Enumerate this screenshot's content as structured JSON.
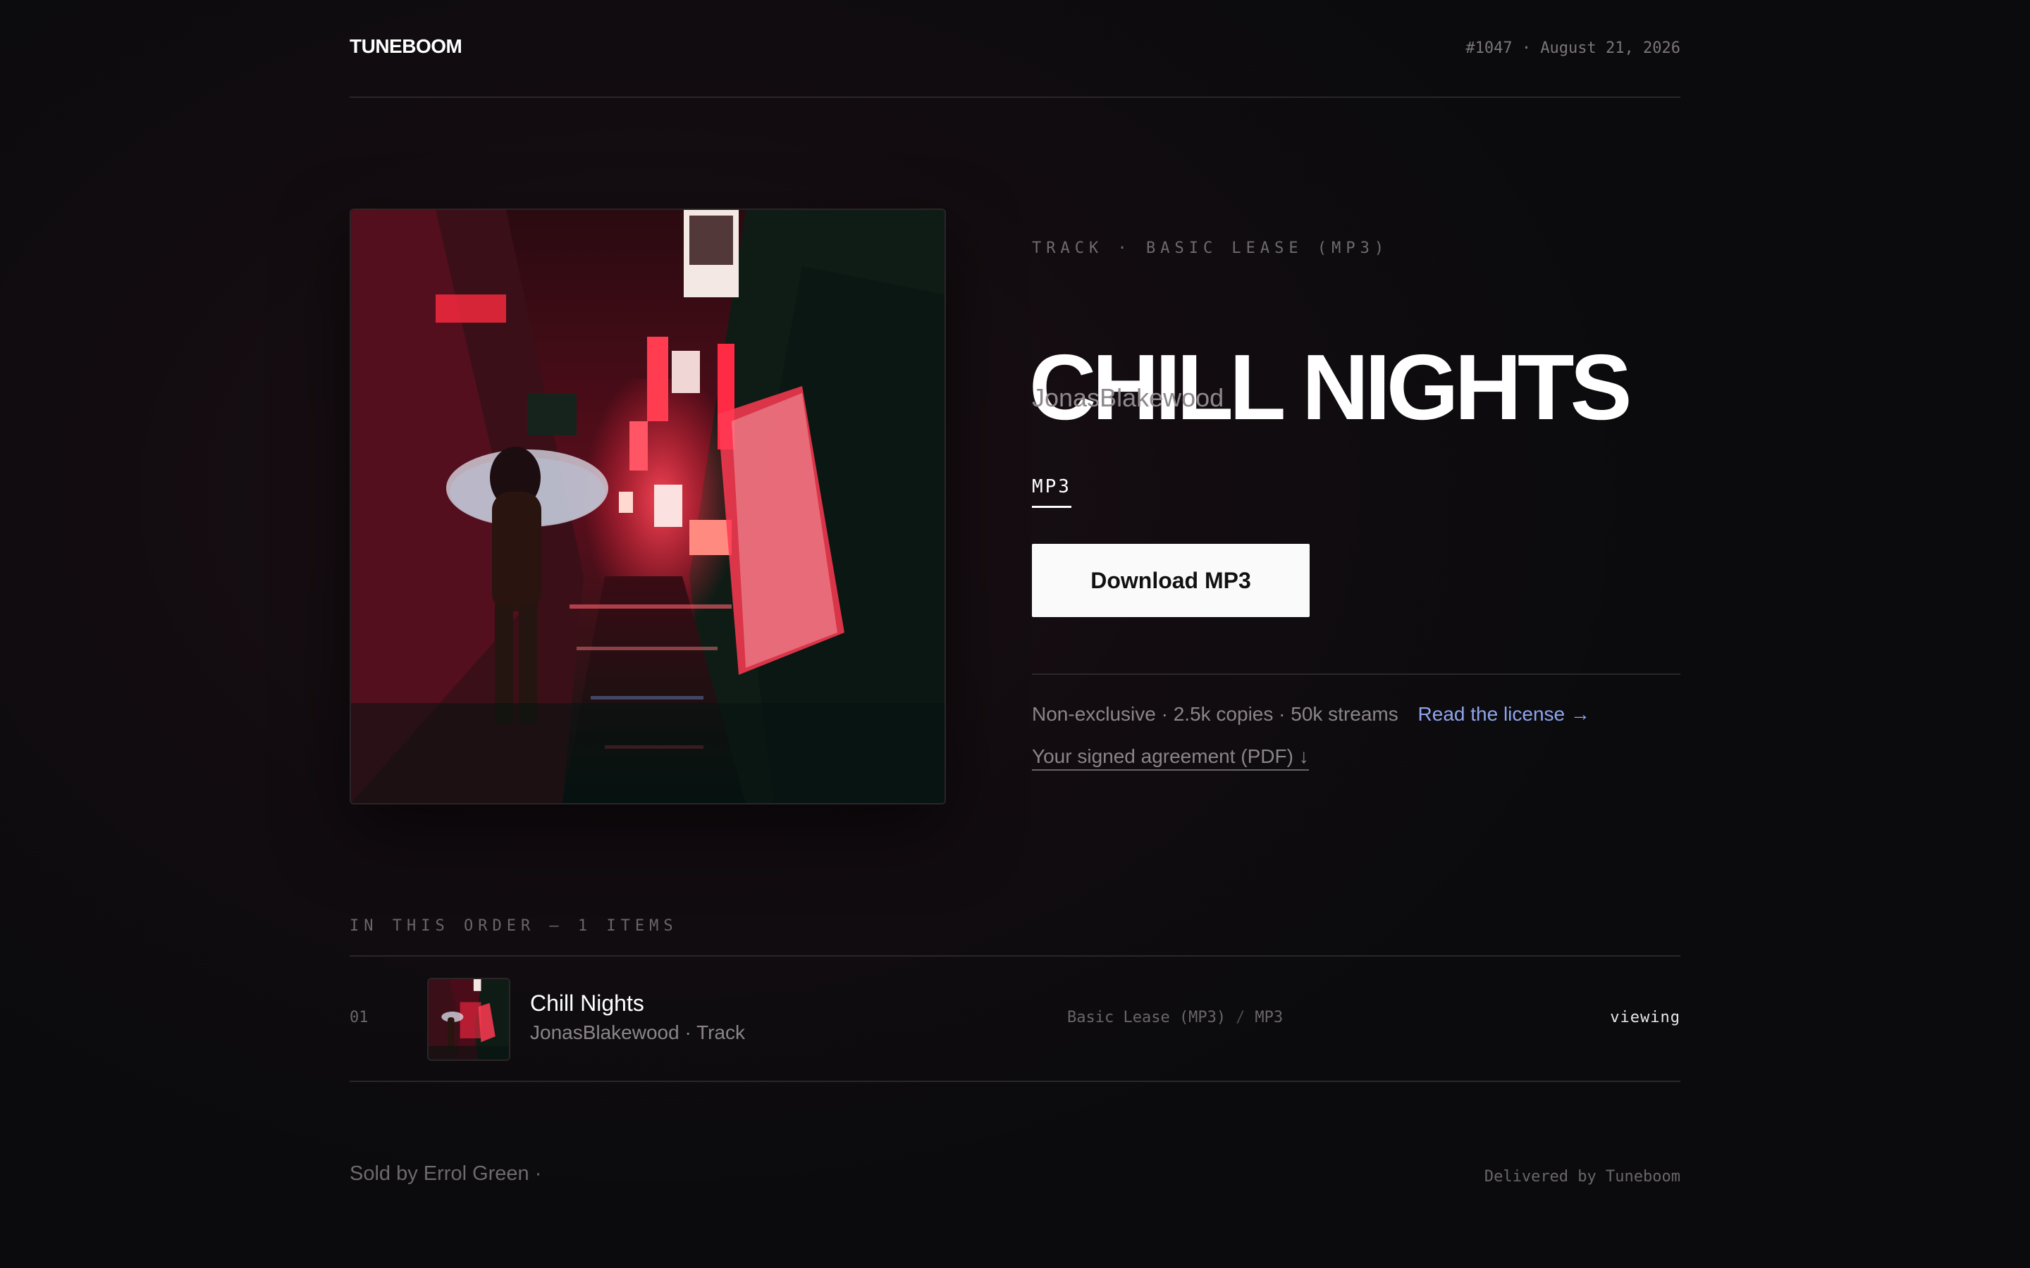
{
  "brand": {
    "logo": "TUNEBOOM"
  },
  "order": {
    "number": "#1047",
    "date": "August 21, 2026",
    "meta_separator": "·"
  },
  "product": {
    "eyebrow": "TRACK · BASIC LEASE (MP3)",
    "title": "CHILL NIGHTS",
    "artist": "JonasBlakewood",
    "format_tab": "MP3",
    "download_label": "Download MP3",
    "license_summary": "Non-exclusive · 2.5k copies · 50k streams",
    "license_link": "Read the license →",
    "agreement_link": "Your signed agreement (PDF) ↓",
    "cover_art": "neon-alley-umbrella-night-photo"
  },
  "order_list": {
    "heading": "IN THIS ORDER — 1 ITEMS",
    "items": [
      {
        "index": "01",
        "title": "Chill Nights",
        "subtitle": "JonasBlakewood · Track",
        "license": "Basic Lease (MP3)",
        "format": "MP3",
        "separator": "/",
        "status": "viewing"
      }
    ]
  },
  "footer": {
    "sold_by": "Sold by Errol Green ·",
    "delivered_by": "Delivered by Tuneboom"
  },
  "colors": {
    "background": "#120c10",
    "accent_link": "#8fa4ec",
    "button_bg": "#fafafa",
    "text_muted": "#8b8588"
  }
}
